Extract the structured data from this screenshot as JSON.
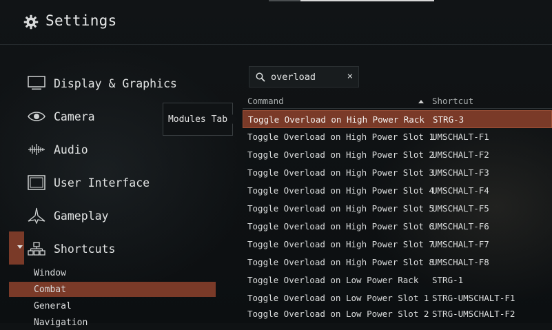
{
  "header": {
    "title": "Settings",
    "icon": "gear-icon"
  },
  "sidebar": {
    "items": [
      {
        "label": "Display & Graphics",
        "icon": "monitor-icon"
      },
      {
        "label": "Camera",
        "icon": "eye-icon"
      },
      {
        "label": "Audio",
        "icon": "audio-wave-icon"
      },
      {
        "label": "User Interface",
        "icon": "window-icon"
      },
      {
        "label": "Gameplay",
        "icon": "ship-icon"
      },
      {
        "label": "Shortcuts",
        "icon": "hierarchy-icon"
      }
    ],
    "shortcuts_subitems": [
      {
        "label": "Window"
      },
      {
        "label": "Combat"
      },
      {
        "label": "General"
      },
      {
        "label": "Navigation"
      }
    ]
  },
  "tooltip": {
    "text": "Modules Tab"
  },
  "search": {
    "value": "overload",
    "clear_glyph": "×"
  },
  "table": {
    "headers": {
      "command": "Command",
      "shortcut": "Shortcut"
    },
    "rows": [
      {
        "command": "Toggle Overload on High Power Rack",
        "shortcut": "STRG-3"
      },
      {
        "command": "Toggle Overload on High Power Slot 1",
        "shortcut": "UMSCHALT-F1"
      },
      {
        "command": "Toggle Overload on High Power Slot 2",
        "shortcut": "UMSCHALT-F2"
      },
      {
        "command": "Toggle Overload on High Power Slot 3",
        "shortcut": "UMSCHALT-F3"
      },
      {
        "command": "Toggle Overload on High Power Slot 4",
        "shortcut": "UMSCHALT-F4"
      },
      {
        "command": "Toggle Overload on High Power Slot 5",
        "shortcut": "UMSCHALT-F5"
      },
      {
        "command": "Toggle Overload on High Power Slot 6",
        "shortcut": "UMSCHALT-F6"
      },
      {
        "command": "Toggle Overload on High Power Slot 7",
        "shortcut": "UMSCHALT-F7"
      },
      {
        "command": "Toggle Overload on High Power Slot 8",
        "shortcut": "UMSCHALT-F8"
      },
      {
        "command": "Toggle Overload on Low Power Rack",
        "shortcut": "STRG-1"
      },
      {
        "command": "Toggle Overload on Low Power Slot 1",
        "shortcut": "STRG-UMSCHALT-F1"
      },
      {
        "command": "Toggle Overload on Low Power Slot 2",
        "shortcut": "STRG-UMSCHALT-F2"
      }
    ]
  },
  "colors": {
    "accent": "#7a3a28",
    "background": "#0f1214",
    "text": "#dcdede"
  }
}
